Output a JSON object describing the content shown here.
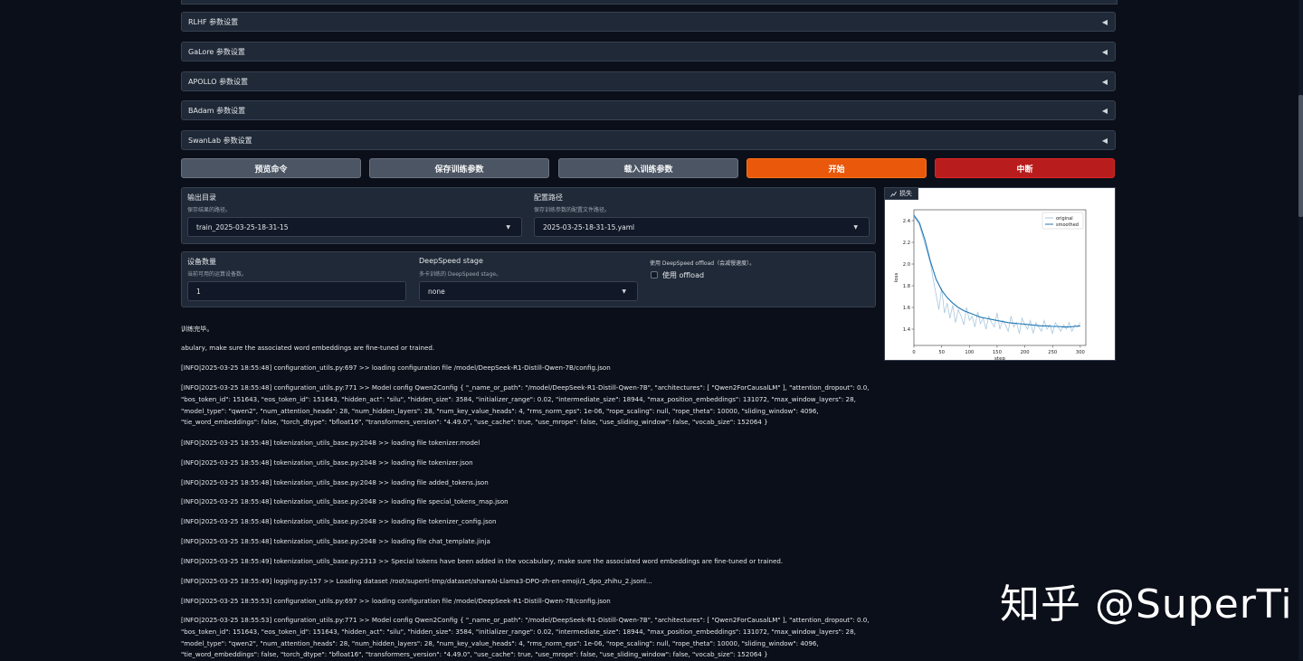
{
  "accordions": [
    {
      "label": "RLHF 参数设置",
      "arrow": "◀"
    },
    {
      "label": "GaLore 参数设置",
      "arrow": "◀"
    },
    {
      "label": "APOLLO 参数设置",
      "arrow": "◀"
    },
    {
      "label": "BAdam 参数设置",
      "arrow": "◀"
    },
    {
      "label": "SwanLab 参数设置",
      "arrow": "◀"
    }
  ],
  "buttons": {
    "preview": "预览命令",
    "save": "保存训练参数",
    "load": "载入训练参数",
    "start": "开始",
    "abort": "中断"
  },
  "output": {
    "output_dir_label": "输出目录",
    "output_dir_info": "保存结果的路径。",
    "output_dir_value": "train_2025-03-25-18-31-15",
    "config_path_label": "配置路径",
    "config_path_info": "保存训练参数的配置文件路径。",
    "config_path_value": "2025-03-25-18-31-15.yaml",
    "dropdown_icon": "▼"
  },
  "device": {
    "device_count_label": "设备数量",
    "device_count_info": "当前可用的运算设备数。",
    "device_count_value": "1",
    "ds_stage_label": "DeepSpeed stage",
    "ds_stage_info": "多卡训练的 DeepSpeed stage。",
    "ds_stage_value": "none",
    "ds_offload_info": "使用 DeepSpeed offload（会减慢速度）。",
    "ds_offload_label": "使用 offload"
  },
  "plot_tab": {
    "icon": "chart-icon",
    "label": "损失"
  },
  "chart_data": {
    "type": "line",
    "title": "",
    "xlabel": "step",
    "ylabel": "loss",
    "xlim": [
      0,
      310
    ],
    "ylim": [
      1.25,
      2.5
    ],
    "xticks": [
      "0",
      "50",
      "100",
      "150",
      "200",
      "250",
      "300"
    ],
    "yticks": [
      "1.4",
      "1.6",
      "1.8",
      "2.0",
      "2.2",
      "2.4"
    ],
    "legend_position": "top-right",
    "series": [
      {
        "name": "original",
        "color": "#a9c7de",
        "x": [
          0,
          10,
          20,
          30,
          35,
          40,
          45,
          50,
          55,
          60,
          65,
          70,
          75,
          80,
          85,
          90,
          95,
          100,
          105,
          110,
          115,
          120,
          125,
          130,
          135,
          140,
          145,
          150,
          155,
          160,
          165,
          170,
          175,
          180,
          185,
          190,
          195,
          200,
          205,
          210,
          215,
          220,
          225,
          230,
          235,
          240,
          245,
          250,
          255,
          260,
          265,
          270,
          275,
          280,
          285,
          290,
          295,
          300
        ],
        "y": [
          2.44,
          2.36,
          2.18,
          2.0,
          1.85,
          1.72,
          1.58,
          1.78,
          1.55,
          1.64,
          1.5,
          1.62,
          1.46,
          1.58,
          1.52,
          1.44,
          1.6,
          1.48,
          1.52,
          1.42,
          1.56,
          1.45,
          1.5,
          1.4,
          1.52,
          1.46,
          1.42,
          1.55,
          1.4,
          1.48,
          1.44,
          1.38,
          1.52,
          1.42,
          1.46,
          1.36,
          1.5,
          1.44,
          1.4,
          1.48,
          1.36,
          1.46,
          1.42,
          1.38,
          1.48,
          1.4,
          1.44,
          1.36,
          1.46,
          1.42,
          1.38,
          1.44,
          1.4,
          1.46,
          1.38,
          1.44,
          1.42,
          1.46
        ]
      },
      {
        "name": "smoothed",
        "color": "#1f77b4",
        "x": [
          0,
          10,
          20,
          30,
          40,
          50,
          60,
          70,
          80,
          90,
          100,
          110,
          120,
          130,
          140,
          150,
          160,
          170,
          180,
          190,
          200,
          210,
          220,
          230,
          240,
          250,
          260,
          270,
          280,
          290,
          300
        ],
        "y": [
          2.45,
          2.38,
          2.22,
          2.02,
          1.86,
          1.76,
          1.69,
          1.64,
          1.6,
          1.57,
          1.55,
          1.53,
          1.51,
          1.5,
          1.49,
          1.48,
          1.47,
          1.46,
          1.455,
          1.45,
          1.445,
          1.44,
          1.435,
          1.43,
          1.43,
          1.425,
          1.425,
          1.42,
          1.42,
          1.425,
          1.43
        ]
      }
    ]
  },
  "log": [
    "训练完毕。",
    "abulary, make sure the associated word embeddings are fine-tuned or trained.",
    "[INFO|2025-03-25 18:55:48] configuration_utils.py:697 >> loading configuration file /model/DeepSeek-R1-Distill-Qwen-7B/config.json",
    "[INFO|2025-03-25 18:55:48] configuration_utils.py:771 >> Model config Qwen2Config { \"_name_or_path\": \"/model/DeepSeek-R1-Distill-Qwen-7B\", \"architectures\": [ \"Qwen2ForCausalLM\" ], \"attention_dropout\": 0.0, \"bos_token_id\": 151643, \"eos_token_id\": 151643, \"hidden_act\": \"silu\", \"hidden_size\": 3584, \"initializer_range\": 0.02, \"intermediate_size\": 18944, \"max_position_embeddings\": 131072, \"max_window_layers\": 28, \"model_type\": \"qwen2\", \"num_attention_heads\": 28, \"num_hidden_layers\": 28, \"num_key_value_heads\": 4, \"rms_norm_eps\": 1e-06, \"rope_scaling\": null, \"rope_theta\": 10000, \"sliding_window\": 4096, \"tie_word_embeddings\": false, \"torch_dtype\": \"bfloat16\", \"transformers_version\": \"4.49.0\", \"use_cache\": true, \"use_mrope\": false, \"use_sliding_window\": false, \"vocab_size\": 152064 }",
    "[INFO|2025-03-25 18:55:48] tokenization_utils_base.py:2048 >> loading file tokenizer.model",
    "[INFO|2025-03-25 18:55:48] tokenization_utils_base.py:2048 >> loading file tokenizer.json",
    "[INFO|2025-03-25 18:55:48] tokenization_utils_base.py:2048 >> loading file added_tokens.json",
    "[INFO|2025-03-25 18:55:48] tokenization_utils_base.py:2048 >> loading file special_tokens_map.json",
    "[INFO|2025-03-25 18:55:48] tokenization_utils_base.py:2048 >> loading file tokenizer_config.json",
    "[INFO|2025-03-25 18:55:48] tokenization_utils_base.py:2048 >> loading file chat_template.jinja",
    "[INFO|2025-03-25 18:55:49] tokenization_utils_base.py:2313 >> Special tokens have been added in the vocabulary, make sure the associated word embeddings are fine-tuned or trained.",
    "[INFO|2025-03-25 18:55:49] logging.py:157 >> Loading dataset /root/superti-tmp/dataset/shareAI-Llama3-DPO-zh-en-emoji/1_dpo_zhihu_2.jsonl...",
    "[INFO|2025-03-25 18:55:53] configuration_utils.py:697 >> loading configuration file /model/DeepSeek-R1-Distill-Qwen-7B/config.json",
    "[INFO|2025-03-25 18:55:53] configuration_utils.py:771 >> Model config Qwen2Config { \"_name_or_path\": \"/model/DeepSeek-R1-Distill-Qwen-7B\", \"architectures\": [ \"Qwen2ForCausalLM\" ], \"attention_dropout\": 0.0, \"bos_token_id\": 151643, \"eos_token_id\": 151643, \"hidden_act\": \"silu\", \"hidden_size\": 3584, \"initializer_range\": 0.02, \"intermediate_size\": 18944, \"max_position_embeddings\": 131072, \"max_window_layers\": 28, \"model_type\": \"qwen2\", \"num_attention_heads\": 28, \"num_hidden_layers\": 28, \"num_key_value_heads\": 4, \"rms_norm_eps\": 1e-06, \"rope_scaling\": null, \"rope_theta\": 10000, \"sliding_window\": 4096, \"tie_word_embeddings\": false, \"torch_dtype\": \"bfloat16\", \"transformers_version\": \"4.49.0\", \"use_cache\": true, \"use_mrope\": false, \"use_sliding_window\": false, \"vocab_size\": 152064 }"
  ],
  "watermark": "知乎 @SuperTi"
}
